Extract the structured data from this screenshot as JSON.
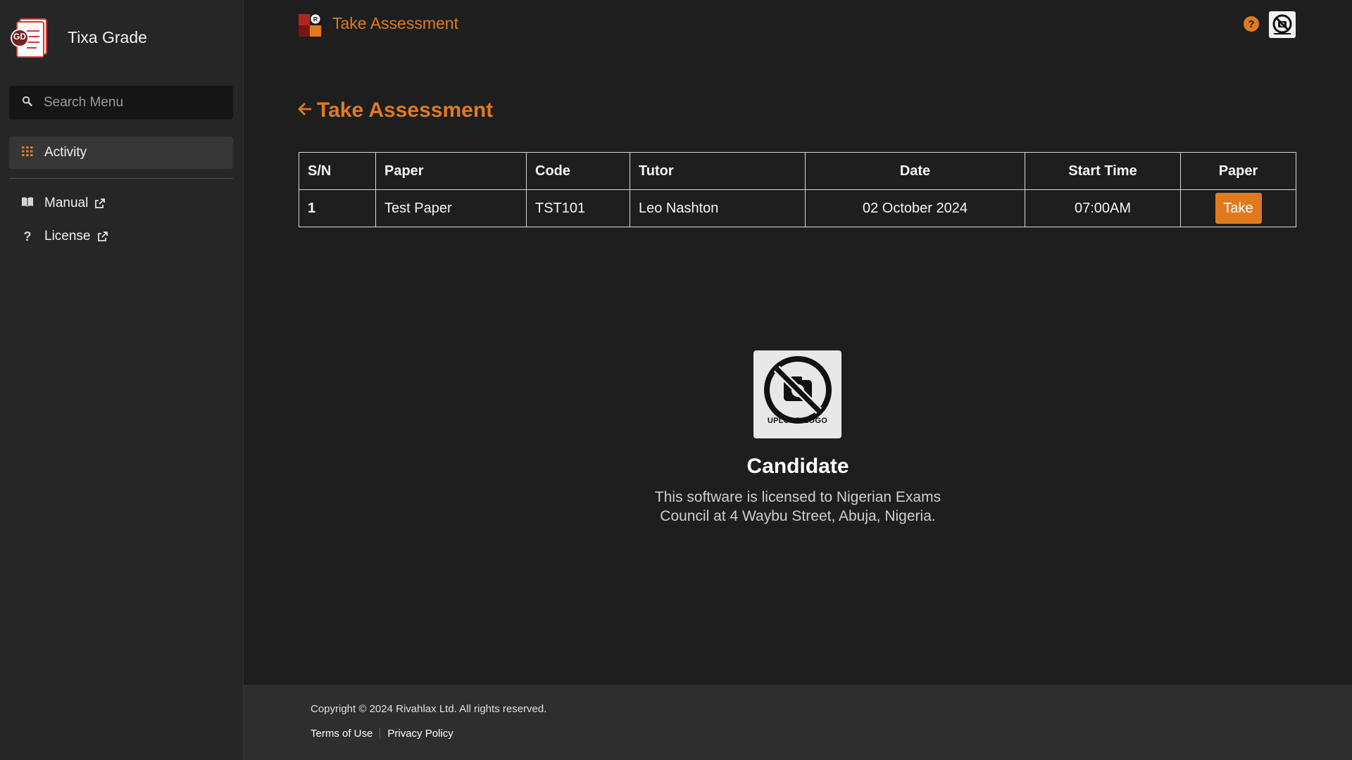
{
  "app": {
    "name": "Tixa Grade",
    "logo_badge": "GD"
  },
  "sidebar": {
    "search_placeholder": "Search Menu",
    "items": [
      {
        "label": "Activity",
        "icon": "grid-icon",
        "active": true
      },
      {
        "label": "Manual",
        "icon": "book-icon",
        "external": true
      },
      {
        "label": "License",
        "icon": "question-icon",
        "external": true
      }
    ]
  },
  "header": {
    "title": "Take Assessment",
    "help_icon": "?",
    "accent_color": "#e07a1f"
  },
  "main": {
    "heading": "Take Assessment",
    "table": {
      "headers": [
        "S/N",
        "Paper",
        "Code",
        "Tutor",
        "Date",
        "Start Time",
        "Paper"
      ],
      "rows": [
        {
          "sn": "1",
          "paper": "Test Paper",
          "code": "TST101",
          "tutor": "Leo Nashton",
          "date": "02 October 2024",
          "start_time": "07:00AM",
          "action": "Take"
        }
      ]
    },
    "candidate": {
      "logo_caption": "UPLOAD LOGO",
      "title": "Candidate",
      "license_line1": "This software is licensed to Nigerian Exams",
      "license_line2": "Council at 4 Waybu Street, Abuja, Nigeria."
    }
  },
  "footer": {
    "copyright": "Copyright © 2024 Rivahlax Ltd. All rights reserved.",
    "links": [
      "Terms of Use",
      "Privacy Policy"
    ]
  }
}
